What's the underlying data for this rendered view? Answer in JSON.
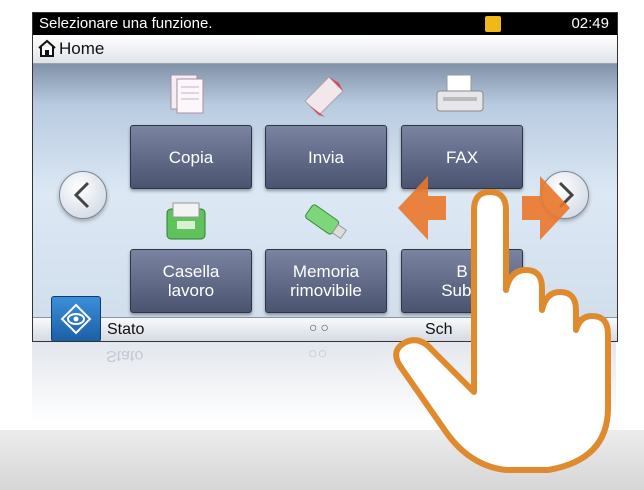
{
  "statusbar": {
    "title": "Selezionare una funzione.",
    "time": "02:49"
  },
  "homebar": {
    "label": "Home"
  },
  "functions": [
    {
      "label": "Copia"
    },
    {
      "label": "Invia"
    },
    {
      "label": "FAX"
    },
    {
      "label": "Casella\nlavoro"
    },
    {
      "label": "Memoria\nrimovibile"
    },
    {
      "label": "B\nSubA"
    }
  ],
  "bottombar": {
    "status_label": "Stato",
    "page_dots": "○○",
    "screen_label": "Sch"
  },
  "reflection": {
    "status_label": "Stato",
    "page_dots": "○○"
  },
  "colors": {
    "button_bg": "#4a5470",
    "hand_outline": "#e08a2e",
    "arrow": "#e9772a"
  }
}
